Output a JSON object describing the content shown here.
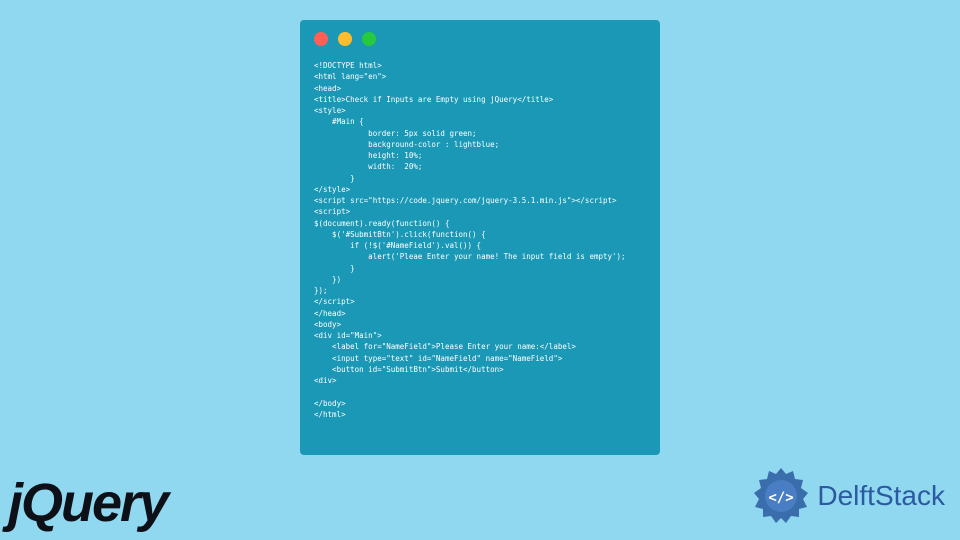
{
  "window": {
    "dot_colors": {
      "red": "#ff5f56",
      "yellow": "#ffbd2e",
      "green": "#27c93f"
    }
  },
  "code": {
    "line1": "<!DOCTYPE html>",
    "line2": "<html lang=\"en\">",
    "line3": "<head>",
    "line4": "<title>Check if Inputs are Empty using jQuery</title>",
    "line5": "<style>",
    "line6": "    #Main {",
    "line7": "            border: 5px solid green;",
    "line8": "            background-color : lightblue;",
    "line9": "            height: 10%;",
    "line10": "            width:  20%;",
    "line11": "        }",
    "line12": "</style>",
    "line13": "<script src=\"https://code.jquery.com/jquery-3.5.1.min.js\"></script>",
    "line14": "<script>",
    "line15": "$(document).ready(function() {",
    "line16": "    $('#SubmitBtn').click(function() {",
    "line17": "        if (!$('#NameField').val()) {",
    "line18": "            alert('Pleae Enter your name! The input field is empty');",
    "line19": "        }",
    "line20": "    })",
    "line21": "});",
    "line22": "</script>",
    "line23": "</head>",
    "line24": "<body>",
    "line25": "<div id=\"Main\">",
    "line26": "    <label for=\"NameField\">Please Enter your name:</label>",
    "line27": "    <input type=\"text\" id=\"NameField\" name=\"NameField\">",
    "line28": "    <button id=\"SubmitBtn\">Submit</button>",
    "line29": "<div>",
    "line30": "",
    "line31": "</body>",
    "line32": "</html>"
  },
  "logos": {
    "jquery": "jQuery",
    "delftstack": "DelftStack"
  }
}
